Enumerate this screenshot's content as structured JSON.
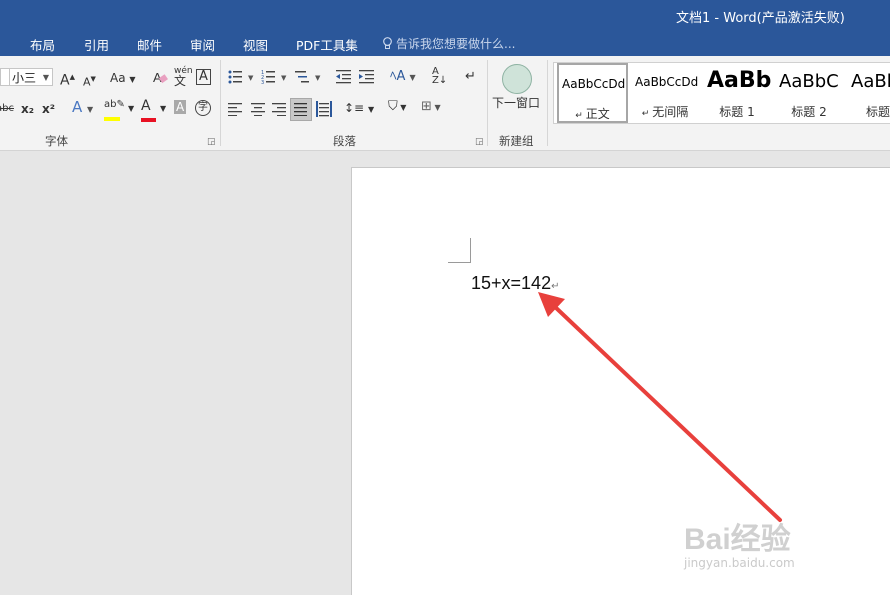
{
  "window": {
    "title": "文档1 - Word(产品激活失败)"
  },
  "tabs": [
    {
      "label": "布局"
    },
    {
      "label": "引用"
    },
    {
      "label": "邮件"
    },
    {
      "label": "审阅"
    },
    {
      "label": "视图"
    },
    {
      "label": "PDF工具集"
    }
  ],
  "tell_me": {
    "placeholder": "告诉我您想要做什么..."
  },
  "ribbon": {
    "font": {
      "label": "字体",
      "size_value": "小三",
      "grow_label": "A",
      "shrink_label": "A",
      "case_label": "Aa",
      "phonetic_top": "wén",
      "phonetic_bottom": "文",
      "border_char_label": "A",
      "strike_label": "abc",
      "subscript_label": "x₂",
      "superscript_label": "x²",
      "effects_label": "A",
      "highlight_label": "ab",
      "font_color_label": "A",
      "shading_label": "A",
      "enclose_label": "字"
    },
    "paragraph": {
      "label": "段落"
    },
    "new_group": {
      "label": "新建组",
      "new_window_label": "下一窗口"
    },
    "styles": {
      "items": [
        {
          "sample": "AaBbCcDd",
          "name": "正文"
        },
        {
          "sample": "AaBbCcDd",
          "name": "无间隔"
        },
        {
          "sample": "AaBb",
          "name": "标题 1"
        },
        {
          "sample": "AaBbC",
          "name": "标题 2"
        },
        {
          "sample": "AaBb",
          "name": "标题"
        }
      ]
    }
  },
  "document": {
    "text": "15+x=142",
    "paragraph_mark": "↵"
  },
  "watermark": {
    "logo": "Bai经验",
    "url": "jingyan.baidu.com"
  },
  "colors": {
    "accent": "#2b579a",
    "arrow": "#e8403c",
    "highlight": "#ffff00",
    "font_color": "#e81123"
  }
}
